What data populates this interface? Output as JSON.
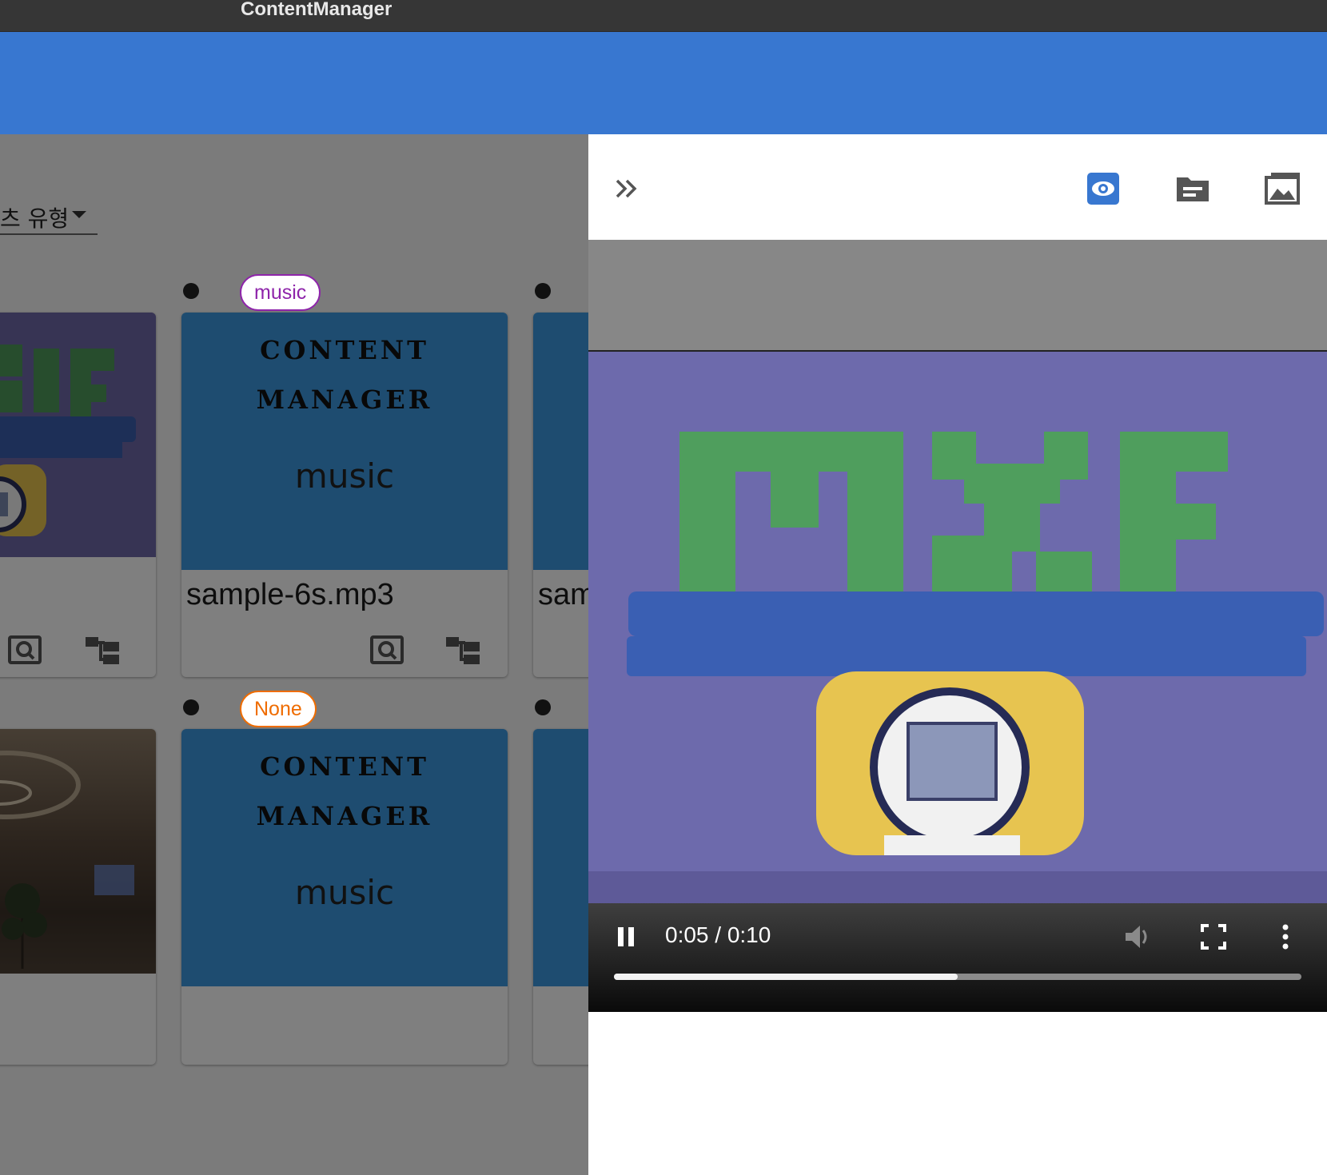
{
  "app": {
    "title": "ContentManager"
  },
  "filter": {
    "label": "츠 유형"
  },
  "cards": [
    {
      "row": 0,
      "col": 0,
      "thumb": "lego-image",
      "file_name": ""
    },
    {
      "row": 0,
      "col": 1,
      "thumb": "music-placeholder",
      "tag": "music",
      "thumb_line1": "CONTENT",
      "thumb_line2": "MANAGER",
      "thumb_sub": "music",
      "file_name": "sample-6s.mp3"
    },
    {
      "row": 0,
      "col": 2,
      "thumb": "music-placeholder",
      "file_name": "sam"
    },
    {
      "row": 1,
      "col": 0,
      "thumb": "room-image",
      "file_name": ""
    },
    {
      "row": 1,
      "col": 1,
      "thumb": "music-placeholder",
      "tag": "None",
      "thumb_line1": "CONTENT",
      "thumb_line2": "MANAGER",
      "thumb_sub": "music",
      "file_name": ""
    },
    {
      "row": 1,
      "col": 2,
      "thumb": "music-placeholder",
      "file_name": ""
    }
  ],
  "card_actions": {
    "preview_icon": "search-preview-icon",
    "tree_icon": "hierarchy-icon"
  },
  "panel": {
    "toolbar": {
      "collapse_icon": "double-chevron-right-icon",
      "view_icon": "eye-icon",
      "metadata_icon": "file-details-icon",
      "gallery_icon": "image-gallery-icon",
      "active": "view"
    },
    "player": {
      "current_time": "0:05",
      "duration": "0:10",
      "time_display": "0:05 / 0:10",
      "progress": 0.5,
      "state": "playing",
      "controls": [
        "pause",
        "volume",
        "fullscreen",
        "more"
      ]
    }
  },
  "colors": {
    "titlebar": "#363636",
    "appbar": "#3877d0",
    "accent": "#3877d0",
    "tag_music": "#8e24aa",
    "tag_none": "#ef6c00",
    "music_thumb": "#3d99e0"
  }
}
